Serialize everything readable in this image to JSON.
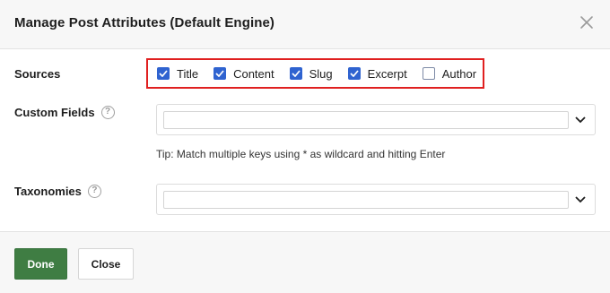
{
  "dialog": {
    "title": "Manage Post Attributes (Default Engine)"
  },
  "sources": {
    "label": "Sources",
    "options": [
      {
        "label": "Title",
        "checked": true
      },
      {
        "label": "Content",
        "checked": true
      },
      {
        "label": "Slug",
        "checked": true
      },
      {
        "label": "Excerpt",
        "checked": true
      },
      {
        "label": "Author",
        "checked": false
      }
    ]
  },
  "custom_fields": {
    "label": "Custom Fields",
    "help_glyph": "?",
    "value": "",
    "tip": "Tip: Match multiple keys using * as wildcard and hitting Enter"
  },
  "taxonomies": {
    "label": "Taxonomies",
    "help_glyph": "?",
    "value": ""
  },
  "footer": {
    "done_label": "Done",
    "close_label": "Close"
  },
  "colors": {
    "accent_checkbox": "#2f63d0",
    "highlight_border": "#e02020",
    "done_button": "#3f7d43"
  },
  "icons": {
    "close": "close-icon",
    "help": "help-icon",
    "dropdown": "chevron-down-icon",
    "check": "checkmark-icon"
  }
}
